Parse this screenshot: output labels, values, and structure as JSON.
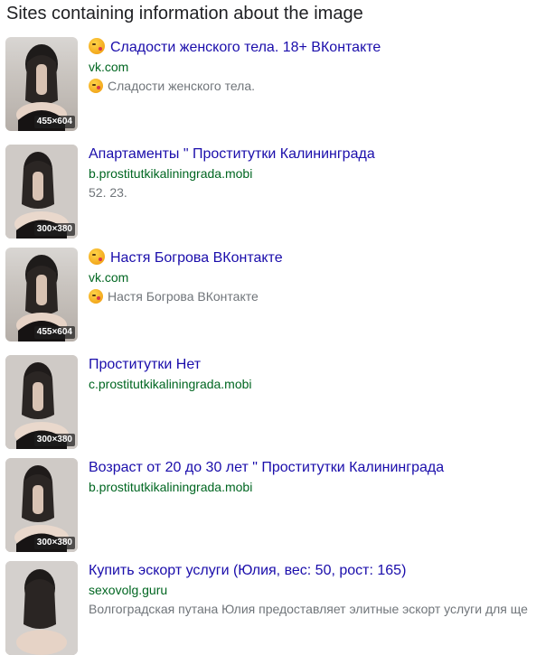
{
  "heading": "Sites containing information about the image",
  "results": [
    {
      "dims": "455×604",
      "title_emoji": true,
      "title": "Сладости женского тела. 18+ ВКонтакте",
      "host": "vk.com",
      "snippet_emoji": true,
      "snippet": "Сладости женского тела."
    },
    {
      "dims": "300×380",
      "title_emoji": false,
      "title": "Апартаменты \" Проститутки Калининграда",
      "host": "b.prostitutkikaliningrada.mobi",
      "snippet_emoji": false,
      "snippet": "52. 23."
    },
    {
      "dims": "455×604",
      "title_emoji": true,
      "title": "Настя Богрова ВКонтакте",
      "host": "vk.com",
      "snippet_emoji": true,
      "snippet": "Настя Богрова ВКонтакте"
    },
    {
      "dims": "300×380",
      "title_emoji": false,
      "title": "Проститутки Нет",
      "host": "c.prostitutkikaliningrada.mobi",
      "snippet_emoji": false,
      "snippet": ""
    },
    {
      "dims": "300×380",
      "title_emoji": false,
      "title": "Возраст от 20 до 30 лет \" Проститутки Калининграда",
      "host": "b.prostitutkikaliningrada.mobi",
      "snippet_emoji": false,
      "snippet": ""
    },
    {
      "dims": "",
      "title_emoji": false,
      "title": "Купить эскорт услуги (Юлия, вес: 50, рост: 165)",
      "host": "sexovolg.guru",
      "snippet_emoji": false,
      "snippet": "Волгоградская путана Юлия предоставляет элитные эскорт услуги для ще"
    }
  ]
}
